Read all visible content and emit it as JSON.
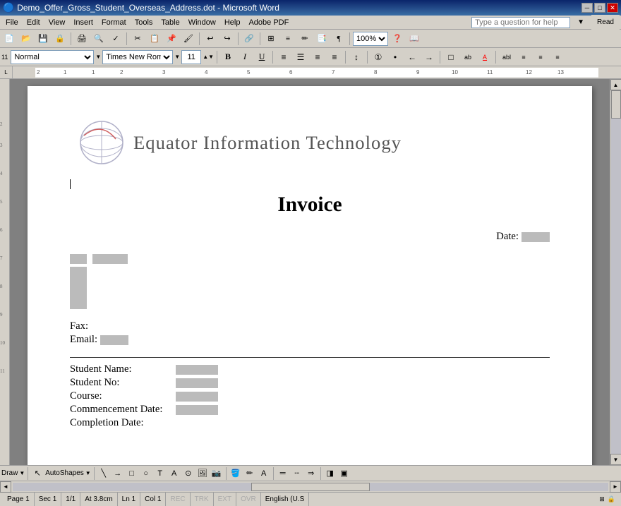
{
  "titlebar": {
    "title": "Demo_Offer_Gross_Student_Overseas_Address.dot - Microsoft Word",
    "min_btn": "─",
    "max_btn": "□",
    "close_btn": "✕"
  },
  "menubar": {
    "items": [
      "File",
      "Edit",
      "View",
      "Insert",
      "Format",
      "Tools",
      "Table",
      "Window",
      "Help",
      "Adobe PDF"
    ],
    "help_placeholder": "Type a question for help",
    "read_btn": "Read"
  },
  "formattingtb": {
    "style": "Normal",
    "font": "Times New Roman",
    "size": "11",
    "bold": "B",
    "italic": "I",
    "underline": "U"
  },
  "zoom": {
    "value": "100%"
  },
  "document": {
    "company_name": "Equator Information Technology",
    "title": "Invoice",
    "date_label": "Date:",
    "fax_label": "Fax:",
    "email_label": "Email:",
    "student_name_label": "Student Name:",
    "student_no_label": "Student No:",
    "course_label": "Course:",
    "commencement_label": "Commencement Date:",
    "completion_label": "Completion Date:"
  },
  "statusbar": {
    "page": "Page 1",
    "sec": "Sec 1",
    "pages": "1/1",
    "at": "At 3.8cm",
    "ln": "Ln 1",
    "col": "Col 1",
    "rec": "REC",
    "trk": "TRK",
    "ext": "EXT",
    "ovr": "OVR",
    "lang": "English (U.S"
  },
  "drawtb": {
    "draw_label": "Draw",
    "autoshapes_label": "AutoShapes"
  }
}
